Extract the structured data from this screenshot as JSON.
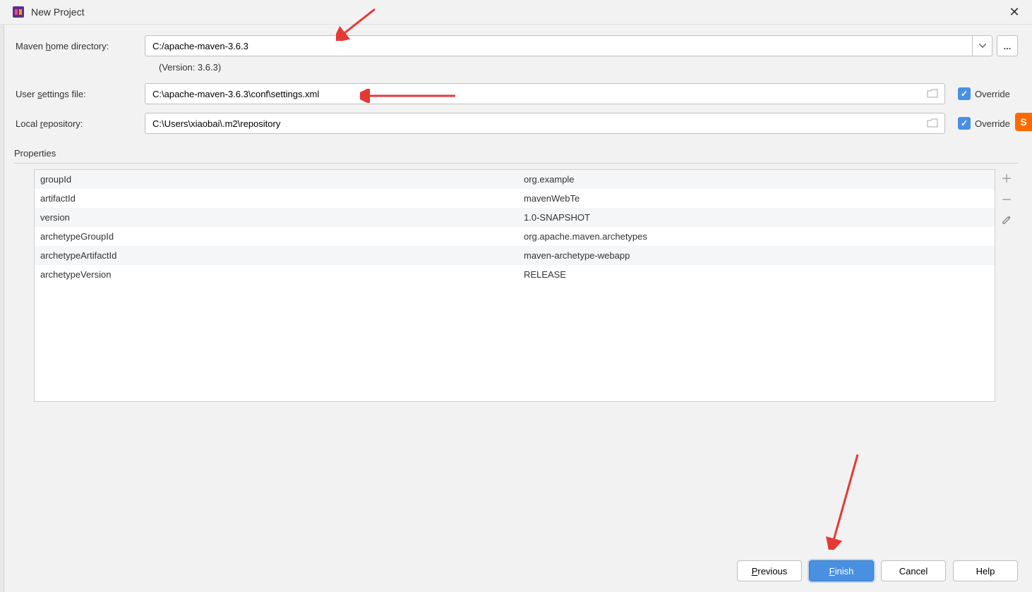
{
  "titlebar": {
    "title": "New Project"
  },
  "form": {
    "mavenHomeLabel": "Maven home directory:",
    "mavenHomeValue": "C:/apache-maven-3.6.3",
    "versionText": "(Version: 3.6.3)",
    "userSettingsLabel": "User settings file:",
    "userSettingsValue": "C:\\apache-maven-3.6.3\\conf\\settings.xml",
    "localRepoLabel": "Local repository:",
    "localRepoValue": "C:\\Users\\xiaobai\\.m2\\repository",
    "overrideLabel1": "Override",
    "overrideLabel2": "Override",
    "moreBtn": "..."
  },
  "propertiesSection": {
    "header": "Properties",
    "rows": [
      {
        "key": "groupId",
        "val": "org.example"
      },
      {
        "key": "artifactId",
        "val": "mavenWebTe"
      },
      {
        "key": "version",
        "val": "1.0-SNAPSHOT"
      },
      {
        "key": "archetypeGroupId",
        "val": "org.apache.maven.archetypes"
      },
      {
        "key": "archetypeArtifactId",
        "val": "maven-archetype-webapp"
      },
      {
        "key": "archetypeVersion",
        "val": "RELEASE"
      }
    ]
  },
  "buttons": {
    "previous": "Previous",
    "finish": "Finish",
    "cancel": "Cancel",
    "help": "Help"
  },
  "sogou": "S"
}
